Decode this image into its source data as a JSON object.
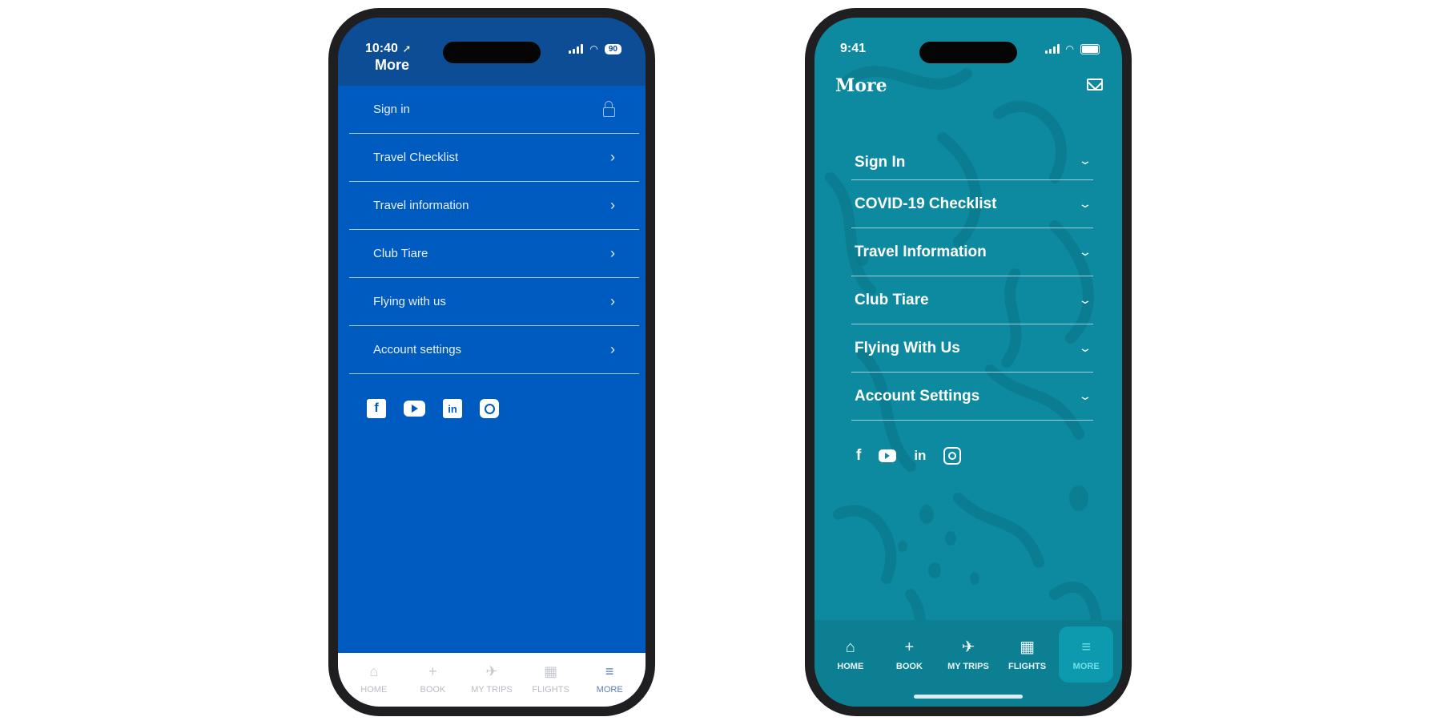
{
  "left_phone": {
    "status": {
      "time": "10:40",
      "battery": "90"
    },
    "title": "More",
    "menu": [
      {
        "label": "Sign in",
        "icon": "lock-icon"
      },
      {
        "label": "Travel Checklist",
        "icon": "chevron-right-icon"
      },
      {
        "label": "Travel information",
        "icon": "chevron-right-icon"
      },
      {
        "label": "Club Tiare",
        "icon": "chevron-right-icon"
      },
      {
        "label": "Flying with us",
        "icon": "chevron-right-icon"
      },
      {
        "label": "Account settings",
        "icon": "chevron-right-icon"
      }
    ],
    "social": [
      "facebook-icon",
      "youtube-icon",
      "linkedin-icon",
      "instagram-icon"
    ],
    "tabs": [
      {
        "label": "HOME",
        "icon": "home-icon"
      },
      {
        "label": "BOOK",
        "icon": "plus-icon"
      },
      {
        "label": "MY TRIPS",
        "icon": "plane-icon"
      },
      {
        "label": "FLIGHTS",
        "icon": "calendar-icon"
      },
      {
        "label": "MORE",
        "icon": "menu-icon",
        "active": true
      }
    ],
    "colors": {
      "background": "#005bc0",
      "header": "#0c4d95"
    }
  },
  "right_phone": {
    "status": {
      "time": "9:41"
    },
    "title": "More",
    "menu": [
      {
        "label": "Sign In",
        "icon": "chevron-down-icon"
      },
      {
        "label": "COVID-19 Checklist",
        "icon": "chevron-down-icon"
      },
      {
        "label": "Travel Information",
        "icon": "chevron-down-icon"
      },
      {
        "label": "Club Tiare",
        "icon": "chevron-down-icon"
      },
      {
        "label": "Flying With Us",
        "icon": "chevron-down-icon"
      },
      {
        "label": "Account Settings",
        "icon": "chevron-down-icon"
      }
    ],
    "social": [
      "facebook-icon",
      "youtube-icon",
      "linkedin-icon",
      "instagram-icon"
    ],
    "tabs": [
      {
        "label": "HOME",
        "icon": "home-icon"
      },
      {
        "label": "BOOK",
        "icon": "plus-icon"
      },
      {
        "label": "MY TRIPS",
        "icon": "plane-icon"
      },
      {
        "label": "FLIGHTS",
        "icon": "calendar-icon"
      },
      {
        "label": "MORE",
        "icon": "menu-icon",
        "active": true
      }
    ],
    "colors": {
      "background": "#0e8aa0",
      "active_tab": "#6fe0ea"
    }
  }
}
